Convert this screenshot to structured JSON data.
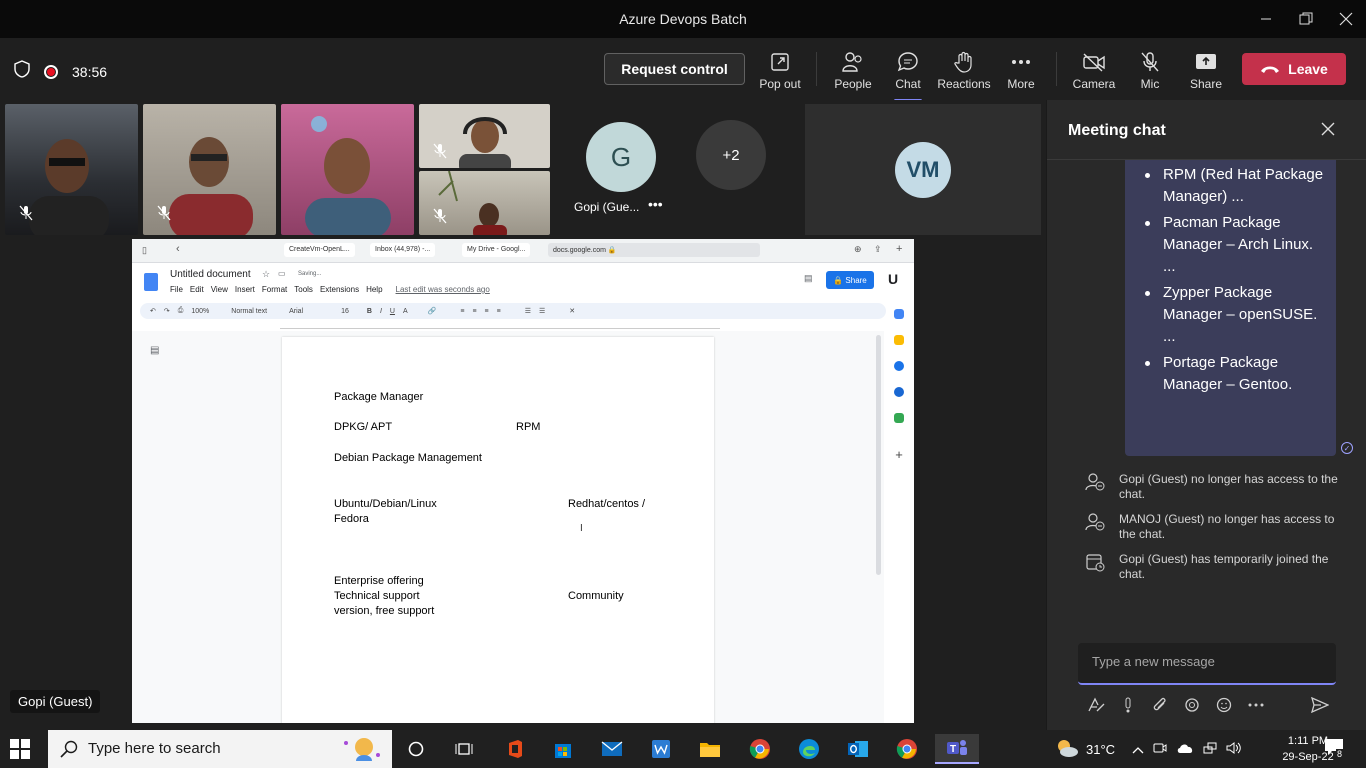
{
  "window": {
    "title": "Azure Devops Batch"
  },
  "toolbar": {
    "timer": "38:56",
    "request_control": "Request control",
    "pop_out": "Pop out",
    "people": "People",
    "chat": "Chat",
    "reactions": "Reactions",
    "more": "More",
    "camera": "Camera",
    "mic": "Mic",
    "share": "Share",
    "leave": "Leave"
  },
  "participants": {
    "gopi_initial": "G",
    "gopi_name": "Gopi (Gue...",
    "overflow_count": "+2",
    "vm_initials": "VM",
    "active_speaker_label": "Gopi (Guest)"
  },
  "browser": {
    "tabs": [
      "CreateVm-OpenL...",
      "Inbox (44,978) -...",
      "My Drive - Googl...",
      "docs.google.com 🔒"
    ]
  },
  "doc": {
    "title": "Untitled document",
    "saving": "Saving...",
    "menu": [
      "File",
      "Edit",
      "View",
      "Insert",
      "Format",
      "Tools",
      "Extensions",
      "Help"
    ],
    "last_edit": "Last edit was seconds ago",
    "share_label": "Share",
    "zoom": "100%",
    "style": "Normal text",
    "font": "Arial",
    "font_size": "16",
    "lines": {
      "heading": "Package Manager",
      "dpkg": "DPKG/ APT",
      "rpm": "RPM",
      "debian": "Debian Package Management",
      "ubuntu": "Ubuntu/Debian/Linux",
      "redhat": "Redhat/centos /",
      "fedora": "Fedora",
      "enterprise": "Enterprise offering",
      "tech": "Technical support",
      "community": "Community",
      "version": "version, free support"
    }
  },
  "chat": {
    "title": "Meeting chat",
    "message_items": [
      "RPM (Red Hat Package Manager) ...",
      "Pacman Package Manager – Arch Linux. ...",
      "Zypper Package Manager – openSUSE. ...",
      "Portage Package Manager – Gentoo."
    ],
    "system_messages": [
      "Gopi (Guest) no longer has access to the chat.",
      "MANOJ (Guest) no longer has access to the chat.",
      "Gopi (Guest) has temporarily joined the chat."
    ],
    "compose_placeholder": "Type a new message"
  },
  "taskbar": {
    "search_placeholder": "Type here to search",
    "temperature": "31°C",
    "time": "1:11 PM",
    "date": "29-Sep-22",
    "notifications": "8"
  },
  "colors": {
    "leave": "#c4314b",
    "accent": "#7f85f5",
    "chat_bubble": "#3b3d5a"
  }
}
